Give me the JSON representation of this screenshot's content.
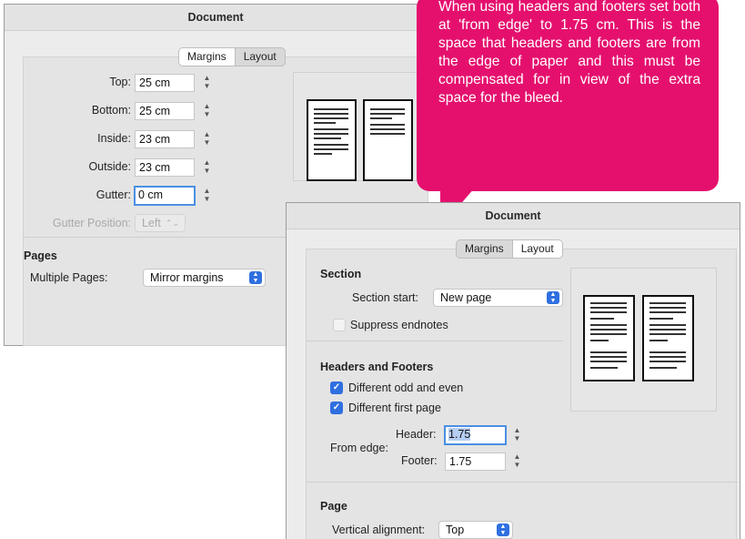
{
  "win1": {
    "title": "Document",
    "tabs": [
      "Margins",
      "Layout"
    ],
    "fields": [
      {
        "label": "Top:",
        "value": "25 cm"
      },
      {
        "label": "Bottom:",
        "value": "25 cm"
      },
      {
        "label": "Inside:",
        "value": "23 cm"
      },
      {
        "label": "Outside:",
        "value": "23 cm"
      },
      {
        "label": "Gutter:",
        "value": "0 cm"
      }
    ],
    "gutter_position": {
      "label": "Gutter Position:",
      "value": "Left"
    },
    "pages_heading": "Pages",
    "multiple_pages": {
      "label": "Multiple Pages:",
      "value": "Mirror margins"
    }
  },
  "win2": {
    "title": "Document",
    "tabs": [
      "Margins",
      "Layout"
    ],
    "section_heading": "Section",
    "section_start": {
      "label": "Section start:",
      "value": "New page"
    },
    "suppress_endnotes": "Suppress endnotes",
    "hf_heading": "Headers and Footers",
    "odd_even": "Different odd and even",
    "first_page": "Different first page",
    "from_edge": "From edge:",
    "header": {
      "label": "Header:",
      "value": "1.75"
    },
    "footer": {
      "label": "Footer:",
      "value": "1.75"
    },
    "page_heading": "Page",
    "vertical_alignment": {
      "label": "Vertical alignment:",
      "value": "Top"
    }
  },
  "callout": {
    "text": "When using headers and footers set both at 'from edge' to 1.75 cm. This is the space that headers and footers are from the edge of paper and this must be compensated for in view of the extra space for the bleed."
  },
  "colors": {
    "callout": "#e5106e",
    "accent": "#2f6fe0",
    "focus": "#4a8fe3"
  }
}
